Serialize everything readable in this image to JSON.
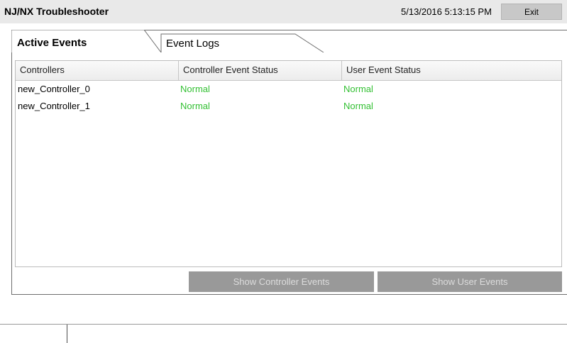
{
  "app": {
    "title": "NJ/NX Troubleshooter",
    "datetime": "5/13/2016 5:13:15 PM",
    "exit_label": "Exit"
  },
  "tabs": [
    {
      "label": "Active Events",
      "active": true
    },
    {
      "label": "Event Logs",
      "active": false
    }
  ],
  "table": {
    "columns": [
      "Controllers",
      "Controller Event Status",
      "User Event Status"
    ],
    "rows": [
      {
        "controller": "new_Controller_0",
        "controller_status": "Normal",
        "user_status": "Normal"
      },
      {
        "controller": "new_Controller_1",
        "controller_status": "Normal",
        "user_status": "Normal"
      }
    ]
  },
  "actions": {
    "show_controller_events": "Show Controller Events",
    "show_user_events": "Show User Events"
  },
  "colors": {
    "status_normal": "#33c033",
    "disabled_button": "#999999",
    "titlebar": "#e9e9e9"
  }
}
